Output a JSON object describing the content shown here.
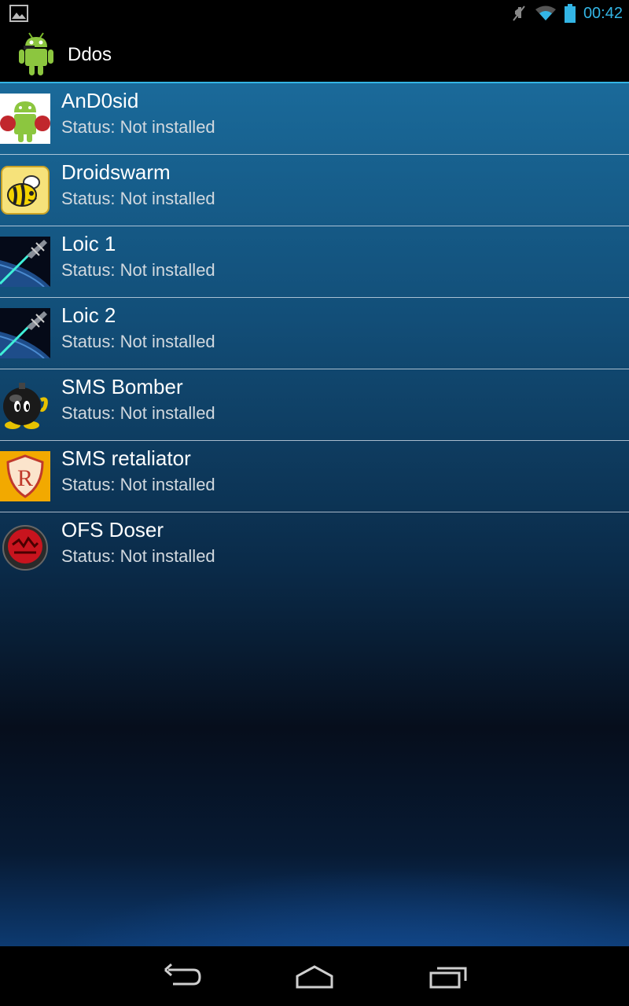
{
  "status_bar": {
    "time": "00:42",
    "icons": [
      "gallery-notification-icon",
      "mute-icon",
      "wifi-icon",
      "battery-icon"
    ],
    "accent_color": "#33b5e5"
  },
  "action_bar": {
    "title": "Ddos",
    "app_icon": "android-robot-icon"
  },
  "apps": [
    {
      "name": "AnD0sid",
      "status": "Status: Not installed",
      "icon": "android-boxer-icon"
    },
    {
      "name": "Droidswarm",
      "status": "Status: Not installed",
      "icon": "bee-icon"
    },
    {
      "name": "Loic 1",
      "status": "Status: Not installed",
      "icon": "space-laser-icon"
    },
    {
      "name": "Loic 2",
      "status": "Status: Not installed",
      "icon": "space-laser-icon"
    },
    {
      "name": "SMS Bomber",
      "status": "Status: Not installed",
      "icon": "bomb-icon"
    },
    {
      "name": "SMS retaliator",
      "status": "Status: Not installed",
      "icon": "r-shield-icon"
    },
    {
      "name": "OFS Doser",
      "status": "Status: Not installed",
      "icon": "red-emblem-icon"
    }
  ],
  "nav_bar": {
    "buttons": [
      "back-icon",
      "home-icon",
      "recents-icon"
    ]
  }
}
